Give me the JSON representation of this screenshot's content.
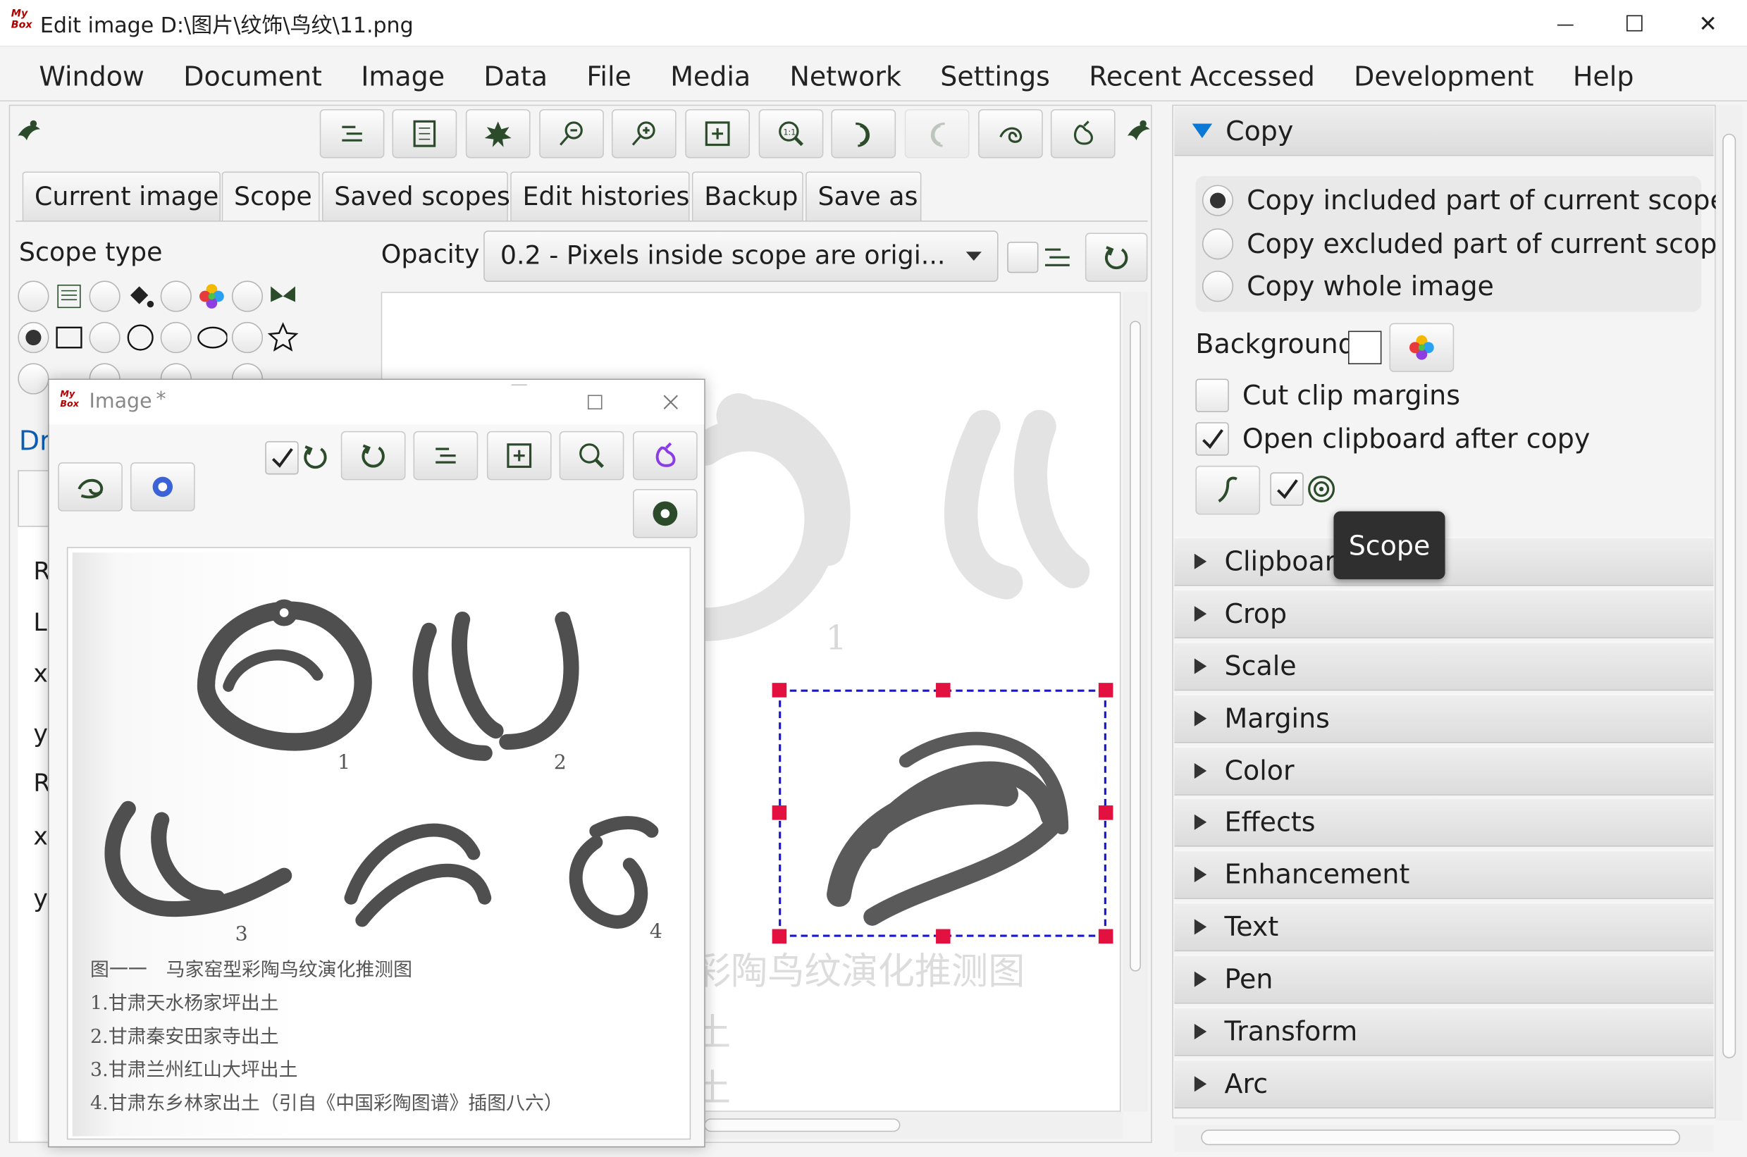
{
  "window": {
    "title": "Edit image D:\\图片\\纹饰\\鸟纹\\11.png",
    "logo": "My Box",
    "controls": [
      "—",
      "☐",
      "✕"
    ]
  },
  "menu": [
    "Window",
    "Document",
    "Image",
    "Data",
    "File",
    "Media",
    "Network",
    "Settings",
    "Recent Accessed",
    "Development",
    "Help"
  ],
  "tabs": [
    "Current image",
    "Scope",
    "Saved scopes",
    "Edit histories",
    "Backup",
    "Save as"
  ],
  "scope": {
    "label": "Scope type",
    "partial_label": "Dr",
    "left_letters": [
      "R",
      "L",
      "x",
      "y",
      "R",
      "x",
      "y"
    ]
  },
  "opacity": {
    "label": "Opacity",
    "value": "0.2 - Pixels inside scope are origi..."
  },
  "canvas": {
    "fig_numbers": [
      "1"
    ],
    "caption_fragment": "彩陶鸟纹演化推测图"
  },
  "image_window": {
    "title": "Image",
    "modified": "*",
    "logo": "My Box"
  },
  "photo": {
    "labels": [
      "1",
      "2",
      "3",
      "4"
    ],
    "caption": "图一一　马家窑型彩陶鸟纹演化推测图",
    "lines": [
      "1.甘肃天水杨家坪出土",
      "2.甘肃秦安田家寺出土",
      "3.甘肃兰州红山大坪出土",
      "4.甘肃东乡林家出土（引自《中国彩陶图谱》插图八六）"
    ]
  },
  "copy": {
    "header": "Copy",
    "options": [
      "Copy included part of current scope",
      "Copy excluded part of current scope",
      "Copy whole image"
    ],
    "selected": 0,
    "background_label": "Background",
    "cut_clip": "Cut clip margins",
    "cut_clip_checked": false,
    "open_clipboard": "Open clipboard after copy",
    "open_clipboard_checked": true
  },
  "tooltip": "Scope",
  "sections": [
    "Clipboard",
    "Crop",
    "Scale",
    "Margins",
    "Color",
    "Effects",
    "Enhancement",
    "Text",
    "Pen",
    "Transform",
    "Arc"
  ],
  "colors": {
    "accent": "#0a78d7",
    "handles": "#e3113f",
    "selection": "#1616d8",
    "icon": "#2b4b2b"
  }
}
